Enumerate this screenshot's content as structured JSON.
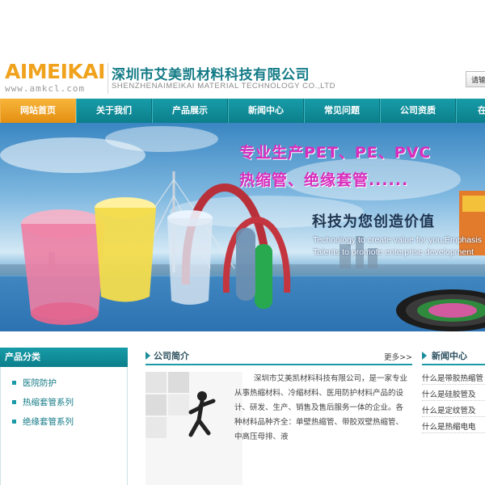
{
  "header": {
    "logo_text": "AIMEIKAI",
    "logo_url": "www.amkcl.com",
    "company_name_cn": "深圳市艾美凯材料科技有限公司",
    "company_name_en": "SHENZHENAIMEIKAI MATERIAL TECHNOLOGY CO.,LTD",
    "top_button_label": "请输"
  },
  "nav": {
    "items": [
      {
        "label": "网站首页",
        "active": true
      },
      {
        "label": "关于我们",
        "active": false
      },
      {
        "label": "产品展示",
        "active": false
      },
      {
        "label": "新闻中心",
        "active": false
      },
      {
        "label": "常见问题",
        "active": false
      },
      {
        "label": "公司资质",
        "active": false
      },
      {
        "label": "在",
        "active": false
      }
    ]
  },
  "banner": {
    "slogan_line1": "专业生产PET、PE、PVC",
    "slogan_line2": "热缩管、绝缘套管......",
    "slogan_cn": "科技为您创造价值",
    "slogan_en_line1": "Technology to create value for you,Emphasis",
    "slogan_en_line2": "Talents to promote enterprise development"
  },
  "sidebar": {
    "title": "产品分类",
    "items": [
      {
        "label": "医院防护"
      },
      {
        "label": "热缩套管系列"
      },
      {
        "label": "绝缘套管系列"
      }
    ]
  },
  "intro": {
    "title": "公司简介",
    "more": "更多>>",
    "text": "深圳市艾美凯材料科技有限公司，是一家专业从事热缩材料、冷缩材料、医用防护材料产品的设计、研发、生产、销售及售后服务一体的企业。各种材料品种齐全：单壁热缩管、带胶双壁热缩管、中高压母排、液"
  },
  "news": {
    "title": "新闻中心",
    "items": [
      {
        "label": "什么是带胶热缩管"
      },
      {
        "label": "什么是硅胶管及"
      },
      {
        "label": "什么是定纹管及"
      },
      {
        "label": "什么是热缩电电"
      }
    ]
  },
  "colors": {
    "brand_orange": "#f0a21c",
    "brand_teal": "#137b86",
    "nav_teal": "#179ca8",
    "nav_active": "#f8b53a",
    "slogan_magenta": "#d82dbd"
  }
}
